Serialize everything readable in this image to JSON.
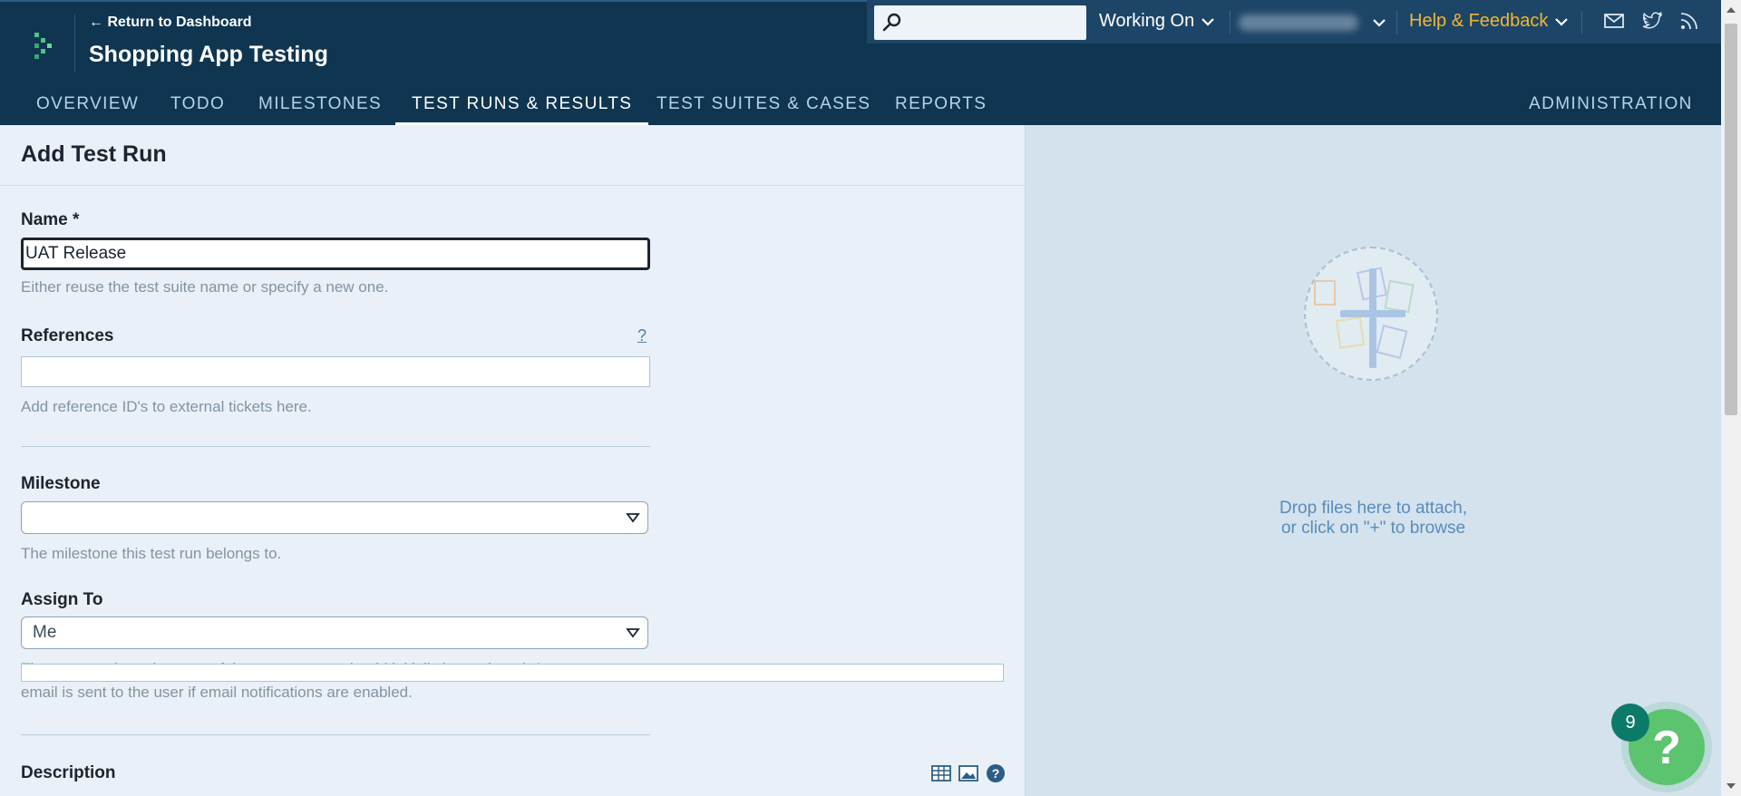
{
  "header": {
    "return_link": "← Return to Dashboard",
    "project_title": "Shopping App Testing",
    "search": {
      "value": "",
      "placeholder": ""
    },
    "working_on": "Working On",
    "help_feedback": "Help & Feedback",
    "nav": [
      {
        "label": "OVERVIEW"
      },
      {
        "label": "TODO"
      },
      {
        "label": "MILESTONES"
      },
      {
        "label": "TEST RUNS & RESULTS",
        "active": true
      },
      {
        "label": "TEST SUITES & CASES"
      },
      {
        "label": "REPORTS"
      },
      {
        "label": "ADMINISTRATION"
      }
    ]
  },
  "form": {
    "title": "Add Test Run",
    "name_label": "Name *",
    "name_value": "UAT Release",
    "name_hint": "Either reuse the test suite name or specify a new one.",
    "references_label": "References",
    "references_help": "?",
    "references_value": "",
    "references_hint": "Add reference ID's to external tickets here.",
    "milestone_label": "Milestone",
    "milestone_value": "",
    "milestone_hint": "The milestone this test run belongs to.",
    "assign_label": "Assign To",
    "assign_value": "Me",
    "assign_hint_1": "The user to whom the tests of the new test run should initially be assigned. An",
    "assign_hint_2": "email is sent to the user if email notifications are enabled.",
    "description_label": "Description"
  },
  "attachments": {
    "drop_line_1": "Drop files here to attach,",
    "drop_line_2": "or click on \"+\" to browse"
  },
  "help_widget": {
    "badge_count": "9",
    "glyph": "?"
  },
  "icons": [
    "logo-icon",
    "search-icon",
    "chevron-down-icon",
    "mail-icon",
    "twitter-icon",
    "rss-icon",
    "caret-down-icon",
    "table-icon",
    "image-icon",
    "help-icon",
    "plus-icon"
  ],
  "colors": {
    "header_bg": "#0f3550",
    "accent_yellow": "#f2b632",
    "link_blue": "#5b8bbd",
    "help_green": "#5cc36f",
    "badge_teal": "#0c7a68"
  }
}
